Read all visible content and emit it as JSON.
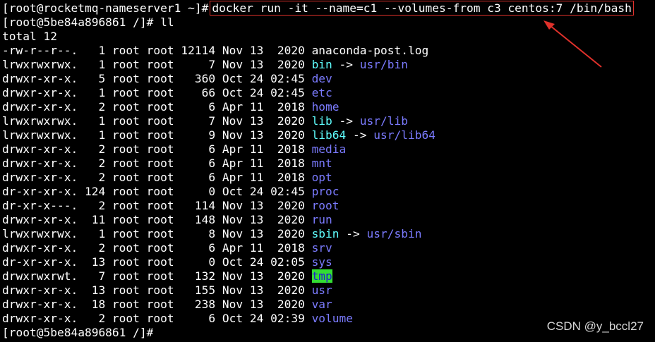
{
  "terminal": {
    "prompt1": "[root@rocketmq-nameserver1 ~]#",
    "command1": "docker run -it --name=c1 --volumes-from c3 centos:7 /bin/bash",
    "prompt2": "[root@5be84a896861 /]#",
    "command2": "ll",
    "total": "total 12",
    "rows": [
      {
        "perm": "-rw-r--r--.",
        "links": "1",
        "owner": "root",
        "group": "root",
        "size": "12114",
        "month": "Nov",
        "day": "13",
        "time": "2020",
        "name": "anaconda-post.log",
        "kind": "file"
      },
      {
        "perm": "lrwxrwxrwx.",
        "links": "1",
        "owner": "root",
        "group": "root",
        "size": "7",
        "month": "Nov",
        "day": "13",
        "time": "2020",
        "name": "bin",
        "kind": "link",
        "target": "usr/bin"
      },
      {
        "perm": "drwxr-xr-x.",
        "links": "5",
        "owner": "root",
        "group": "root",
        "size": "360",
        "month": "Oct",
        "day": "24",
        "time": "02:45",
        "name": "dev",
        "kind": "dir"
      },
      {
        "perm": "drwxr-xr-x.",
        "links": "1",
        "owner": "root",
        "group": "root",
        "size": "66",
        "month": "Oct",
        "day": "24",
        "time": "02:45",
        "name": "etc",
        "kind": "dir"
      },
      {
        "perm": "drwxr-xr-x.",
        "links": "2",
        "owner": "root",
        "group": "root",
        "size": "6",
        "month": "Apr",
        "day": "11",
        "time": "2018",
        "name": "home",
        "kind": "dir"
      },
      {
        "perm": "lrwxrwxrwx.",
        "links": "1",
        "owner": "root",
        "group": "root",
        "size": "7",
        "month": "Nov",
        "day": "13",
        "time": "2020",
        "name": "lib",
        "kind": "link",
        "target": "usr/lib"
      },
      {
        "perm": "lrwxrwxrwx.",
        "links": "1",
        "owner": "root",
        "group": "root",
        "size": "9",
        "month": "Nov",
        "day": "13",
        "time": "2020",
        "name": "lib64",
        "kind": "link",
        "target": "usr/lib64"
      },
      {
        "perm": "drwxr-xr-x.",
        "links": "2",
        "owner": "root",
        "group": "root",
        "size": "6",
        "month": "Apr",
        "day": "11",
        "time": "2018",
        "name": "media",
        "kind": "dir"
      },
      {
        "perm": "drwxr-xr-x.",
        "links": "2",
        "owner": "root",
        "group": "root",
        "size": "6",
        "month": "Apr",
        "day": "11",
        "time": "2018",
        "name": "mnt",
        "kind": "dir"
      },
      {
        "perm": "drwxr-xr-x.",
        "links": "2",
        "owner": "root",
        "group": "root",
        "size": "6",
        "month": "Apr",
        "day": "11",
        "time": "2018",
        "name": "opt",
        "kind": "dir"
      },
      {
        "perm": "dr-xr-xr-x.",
        "links": "124",
        "owner": "root",
        "group": "root",
        "size": "0",
        "month": "Oct",
        "day": "24",
        "time": "02:45",
        "name": "proc",
        "kind": "dir"
      },
      {
        "perm": "dr-xr-x---.",
        "links": "2",
        "owner": "root",
        "group": "root",
        "size": "114",
        "month": "Nov",
        "day": "13",
        "time": "2020",
        "name": "root",
        "kind": "dir"
      },
      {
        "perm": "drwxr-xr-x.",
        "links": "11",
        "owner": "root",
        "group": "root",
        "size": "148",
        "month": "Nov",
        "day": "13",
        "time": "2020",
        "name": "run",
        "kind": "dir"
      },
      {
        "perm": "lrwxrwxrwx.",
        "links": "1",
        "owner": "root",
        "group": "root",
        "size": "8",
        "month": "Nov",
        "day": "13",
        "time": "2020",
        "name": "sbin",
        "kind": "link",
        "target": "usr/sbin"
      },
      {
        "perm": "drwxr-xr-x.",
        "links": "2",
        "owner": "root",
        "group": "root",
        "size": "6",
        "month": "Apr",
        "day": "11",
        "time": "2018",
        "name": "srv",
        "kind": "dir"
      },
      {
        "perm": "dr-xr-xr-x.",
        "links": "13",
        "owner": "root",
        "group": "root",
        "size": "0",
        "month": "Oct",
        "day": "24",
        "time": "02:05",
        "name": "sys",
        "kind": "dir"
      },
      {
        "perm": "drwxrwxrwt.",
        "links": "7",
        "owner": "root",
        "group": "root",
        "size": "132",
        "month": "Nov",
        "day": "13",
        "time": "2020",
        "name": "tmp",
        "kind": "sticky"
      },
      {
        "perm": "drwxr-xr-x.",
        "links": "13",
        "owner": "root",
        "group": "root",
        "size": "155",
        "month": "Nov",
        "day": "13",
        "time": "2020",
        "name": "usr",
        "kind": "dir"
      },
      {
        "perm": "drwxr-xr-x.",
        "links": "18",
        "owner": "root",
        "group": "root",
        "size": "238",
        "month": "Nov",
        "day": "13",
        "time": "2020",
        "name": "var",
        "kind": "dir"
      },
      {
        "perm": "drwxr-xr-x.",
        "links": "2",
        "owner": "root",
        "group": "root",
        "size": "6",
        "month": "Oct",
        "day": "24",
        "time": "02:39",
        "name": "volume",
        "kind": "dir"
      }
    ],
    "link_arrow": "->",
    "prompt3": "[root@5be84a896861 /]#"
  },
  "colors": {
    "dir": "#7b7bff",
    "link": "#5fffff",
    "highlight_border": "#e0312b",
    "sticky_bg": "#33dd33",
    "sticky_fg": "#2222cc"
  },
  "icons": {
    "annotation": "arrow-icon"
  },
  "watermark": "CSDN @y_bccl27"
}
